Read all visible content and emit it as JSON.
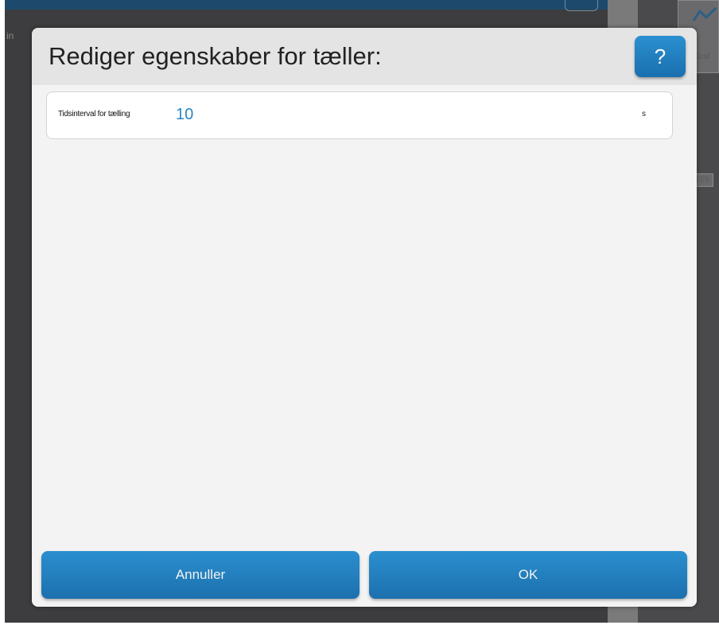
{
  "background": {
    "left_text": "in",
    "right_tab_label": "Graf",
    "right_label_2": "t Ek"
  },
  "dialog": {
    "title": "Rediger egenskaber for tæller:",
    "help_label": "?",
    "field": {
      "label": "Tidsinterval for tælling",
      "value": "10",
      "unit": "s"
    },
    "cancel_label": "Annuller",
    "ok_label": "OK"
  },
  "colors": {
    "accent": "#1f7fc1",
    "value_text": "#2a86c8"
  },
  "icons": {
    "help": "question-mark-icon",
    "graph": "line-graph-icon"
  }
}
